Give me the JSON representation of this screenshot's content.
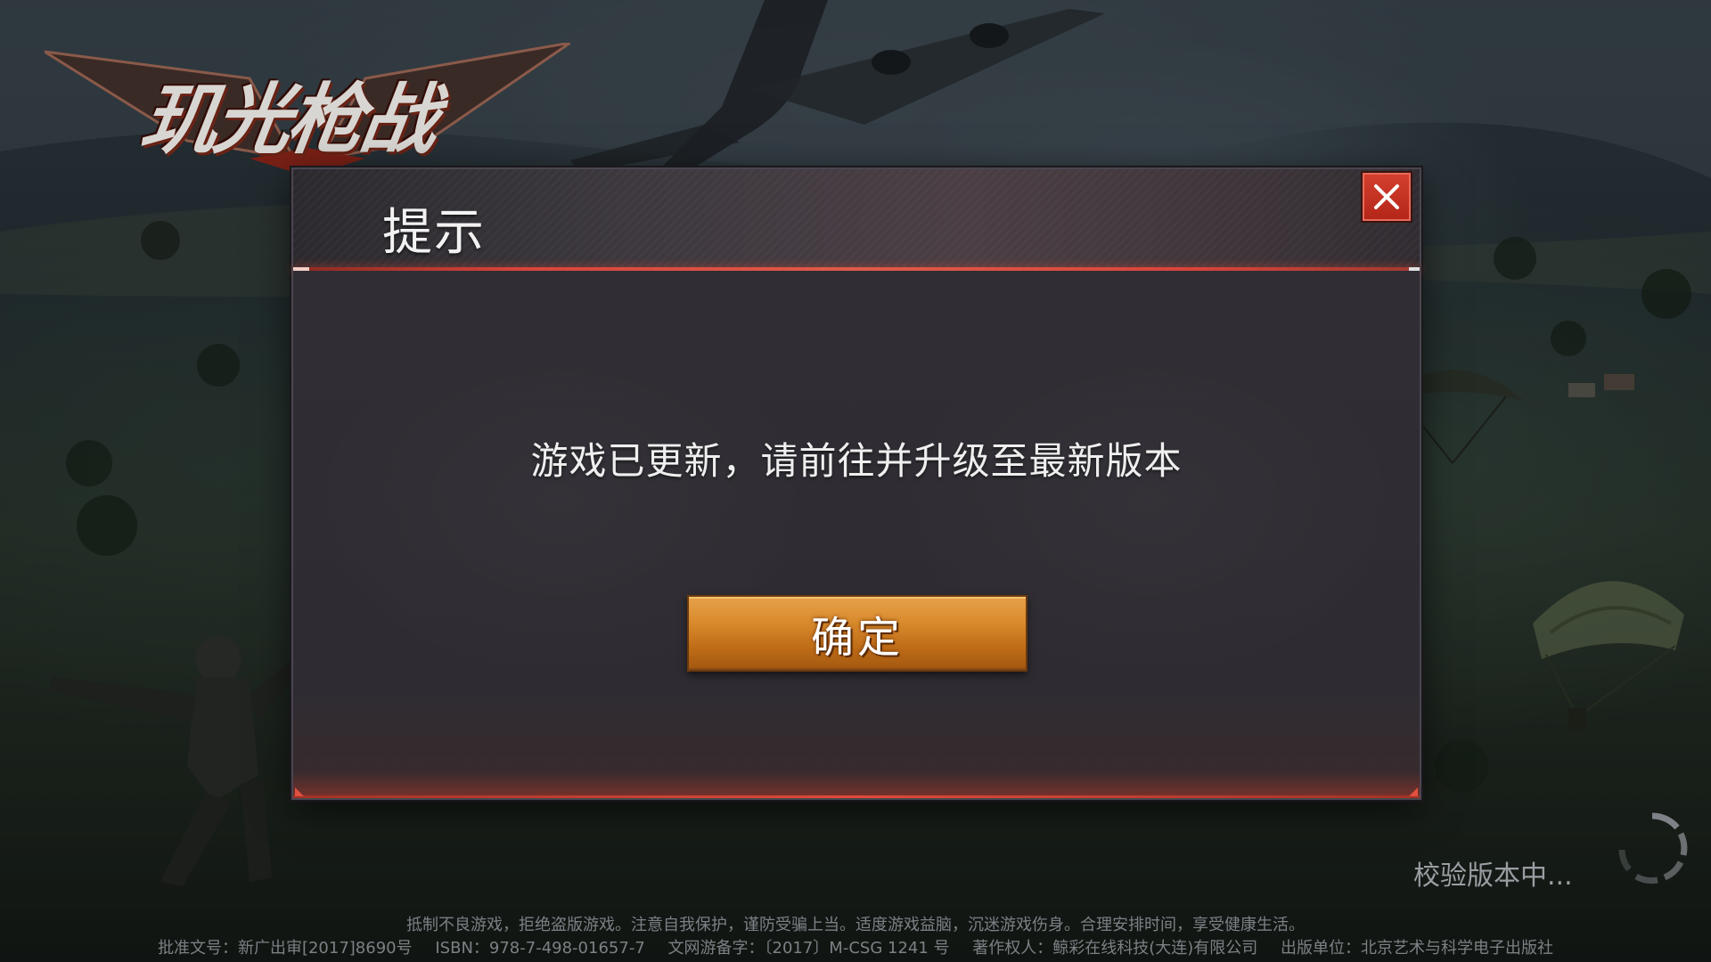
{
  "logo": {
    "text": "玑光枪战"
  },
  "dialog": {
    "title": "提示",
    "message": "游戏已更新，请前往并升级至最新版本",
    "confirm_label": "确定",
    "close_icon": "close-icon",
    "accent_color": "#d9443a",
    "button_color": "#d98a2c"
  },
  "status": {
    "loading_text": "校验版本中..."
  },
  "footer": {
    "health_notice": "抵制不良游戏，拒绝盗版游戏。注意自我保护，谨防受骗上当。适度游戏益脑，沉迷游戏伤身。合理安排时间，享受健康生活。",
    "approval": "批准文号：新广出审[2017]8690号",
    "isbn": "ISBN：978-7-498-01657-7",
    "filing": "文网游备字：〔2017〕M-CSG 1241 号",
    "copyright": "著作权人：鲸彩在线科技(大连)有限公司",
    "publisher": "出版单位：北京艺术与科学电子出版社"
  }
}
